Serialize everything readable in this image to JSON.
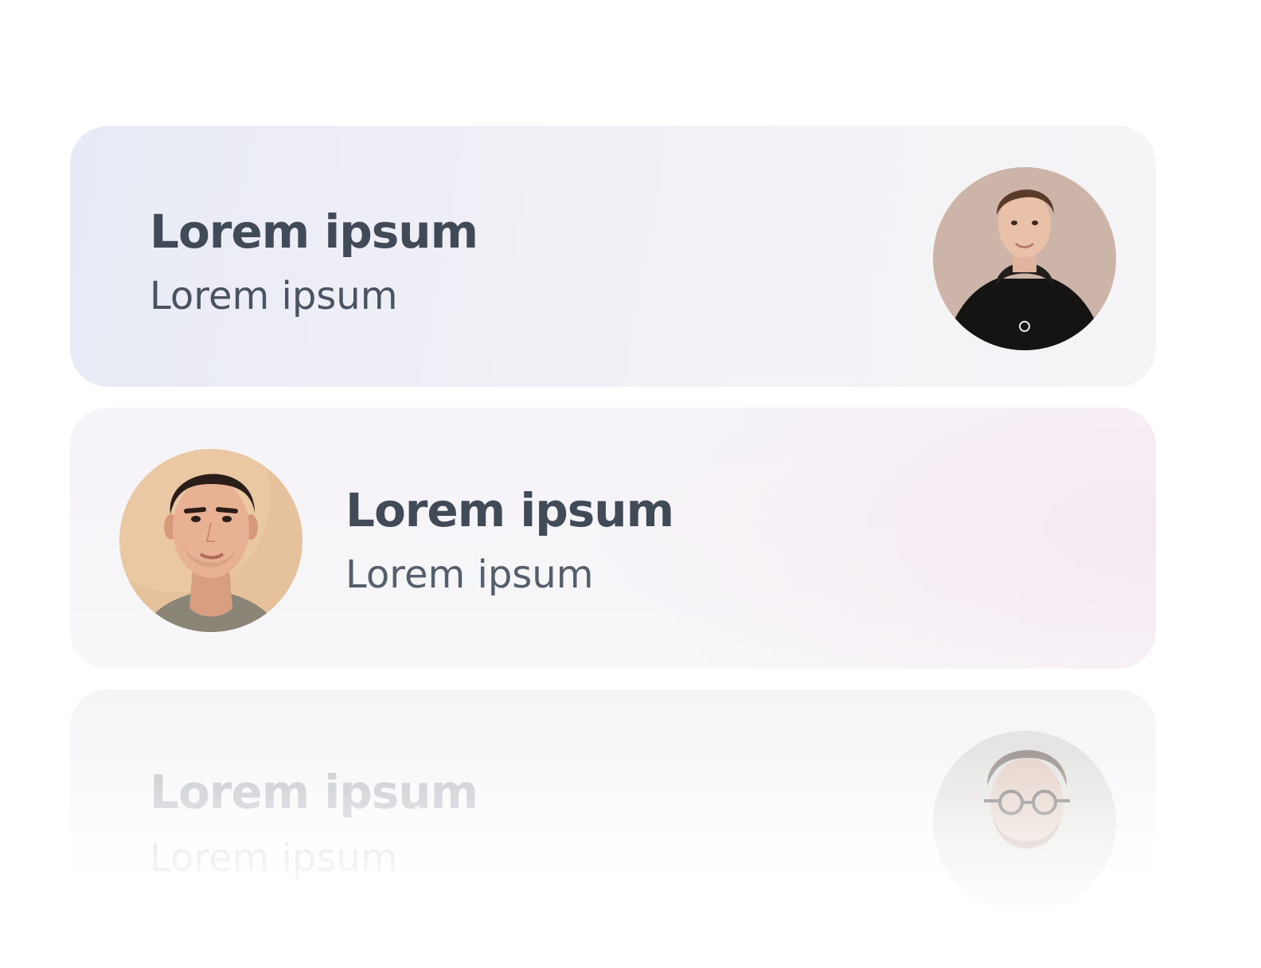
{
  "cards": [
    {
      "title": "Lorem ipsum",
      "subtitle": "Lorem ipsum",
      "avatar_icon": "avatar-photo-hoodie-man"
    },
    {
      "title": "Lorem ipsum",
      "subtitle": "Lorem ipsum",
      "avatar_icon": "avatar-photo-dark-hair-man"
    },
    {
      "title": "Lorem ipsum",
      "subtitle": "Lorem ipsum",
      "avatar_icon": "avatar-photo-glasses-man"
    }
  ],
  "colors": {
    "title_text": "#414b57",
    "subtitle_text": "#4a5461",
    "card_1_tint": "#e8ebf6",
    "card_2_tint": "#f6e9f2"
  }
}
